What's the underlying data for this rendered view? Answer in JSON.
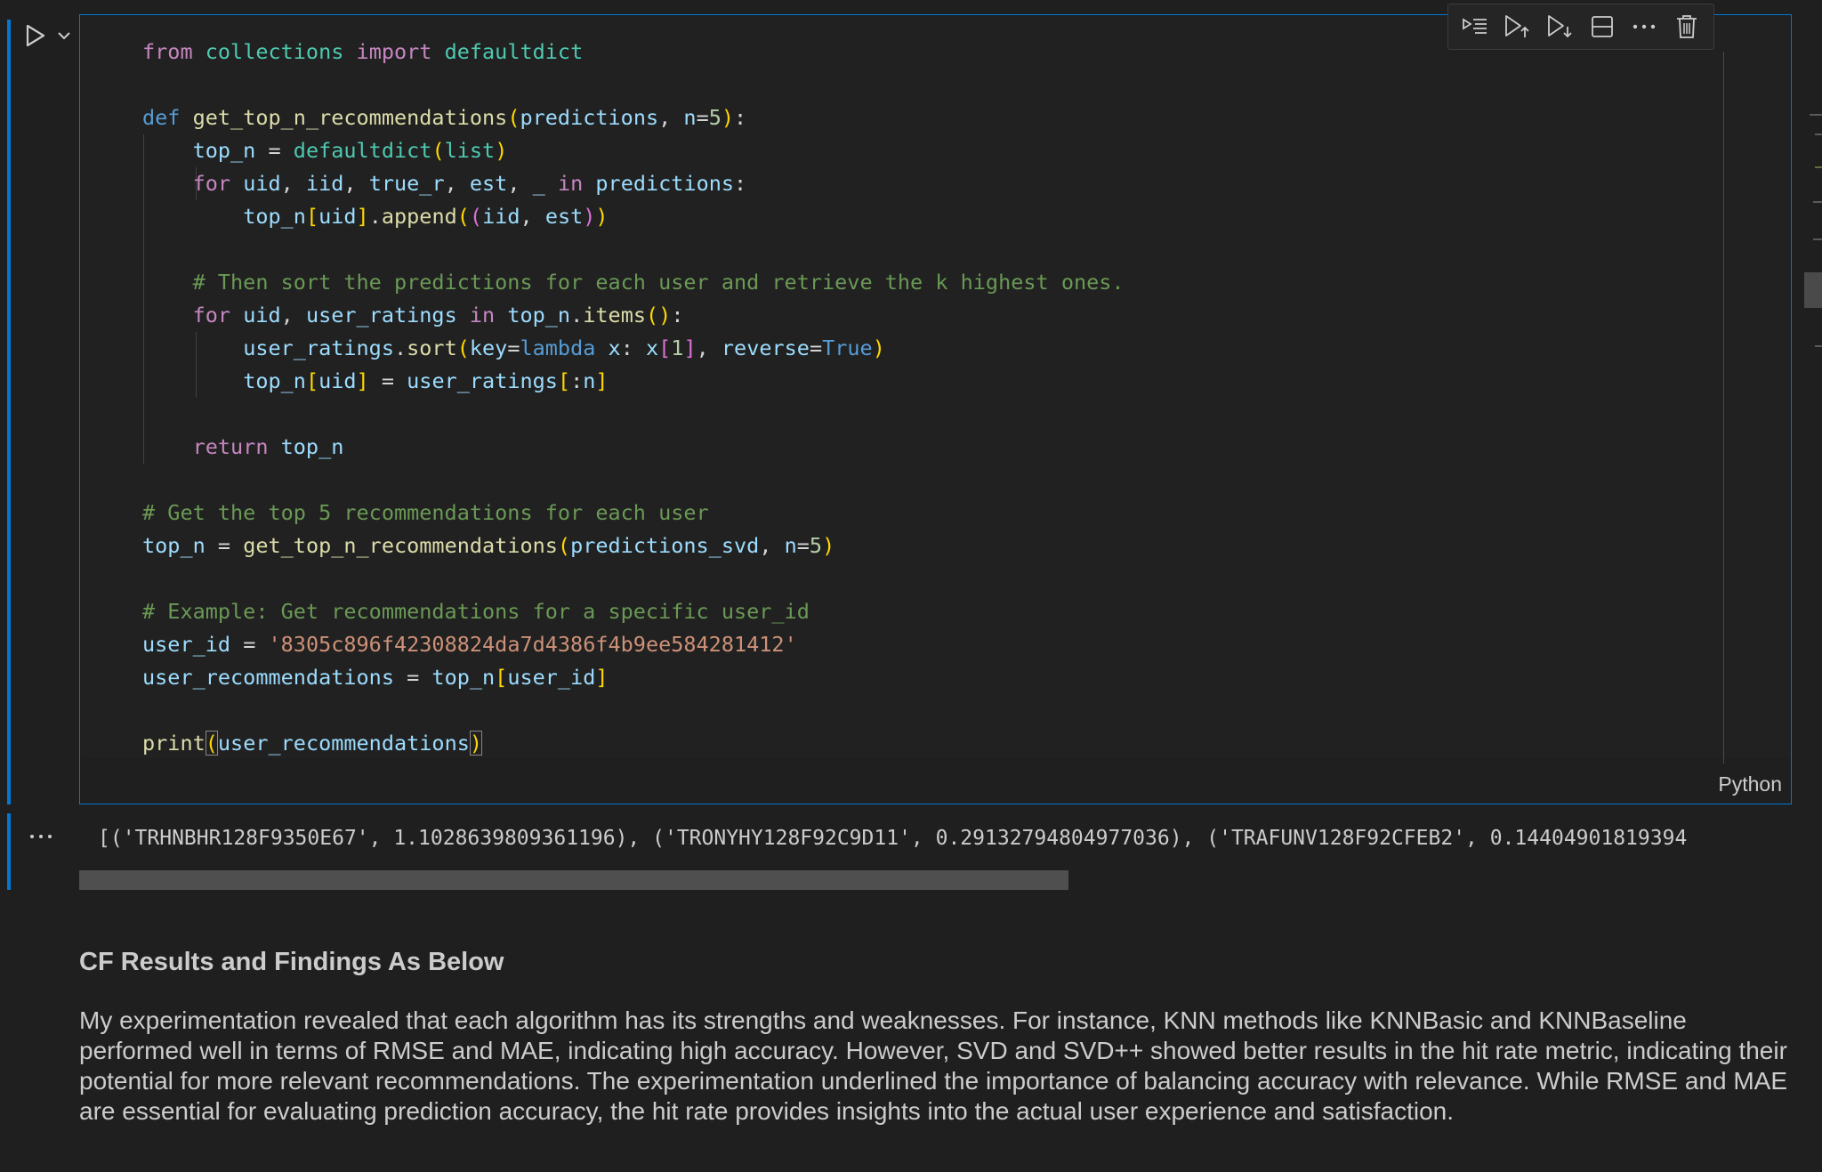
{
  "code_cell": {
    "language": "Python",
    "lines": [
      [
        [
          "kw",
          "from"
        ],
        [
          "op",
          " "
        ],
        [
          "cls",
          "collections"
        ],
        [
          "op",
          " "
        ],
        [
          "kw",
          "import"
        ],
        [
          "op",
          " "
        ],
        [
          "cls",
          "defaultdict"
        ]
      ],
      [],
      [
        [
          "def",
          "def"
        ],
        [
          "op",
          " "
        ],
        [
          "fn",
          "get_top_n_recommendations"
        ],
        [
          "p1",
          "("
        ],
        [
          "var",
          "predictions"
        ],
        [
          "op",
          ", "
        ],
        [
          "var",
          "n"
        ],
        [
          "op",
          "="
        ],
        [
          "num",
          "5"
        ],
        [
          "p1",
          ")"
        ],
        [
          "op",
          ":"
        ]
      ],
      [
        [
          "op",
          "    "
        ],
        [
          "var",
          "top_n"
        ],
        [
          "op",
          " = "
        ],
        [
          "cls",
          "defaultdict"
        ],
        [
          "p1",
          "("
        ],
        [
          "cls",
          "list"
        ],
        [
          "p1",
          ")"
        ]
      ],
      [
        [
          "op",
          "    "
        ],
        [
          "kw",
          "for"
        ],
        [
          "op",
          " "
        ],
        [
          "var",
          "uid"
        ],
        [
          "op",
          ", "
        ],
        [
          "var",
          "iid"
        ],
        [
          "op",
          ", "
        ],
        [
          "var",
          "true_r"
        ],
        [
          "op",
          ", "
        ],
        [
          "var",
          "est"
        ],
        [
          "op",
          ", "
        ],
        [
          "var",
          "_"
        ],
        [
          "op",
          " "
        ],
        [
          "kw",
          "in"
        ],
        [
          "op",
          " "
        ],
        [
          "var",
          "predictions"
        ],
        [
          "op",
          ":"
        ]
      ],
      [
        [
          "op",
          "        "
        ],
        [
          "var",
          "top_n"
        ],
        [
          "p1",
          "["
        ],
        [
          "var",
          "uid"
        ],
        [
          "p1",
          "]"
        ],
        [
          "op",
          "."
        ],
        [
          "fn",
          "append"
        ],
        [
          "p1",
          "("
        ],
        [
          "p2",
          "("
        ],
        [
          "var",
          "iid"
        ],
        [
          "op",
          ", "
        ],
        [
          "var",
          "est"
        ],
        [
          "p2",
          ")"
        ],
        [
          "p1",
          ")"
        ]
      ],
      [],
      [
        [
          "op",
          "    "
        ],
        [
          "cm",
          "# Then sort the predictions for each user and retrieve the k highest ones."
        ]
      ],
      [
        [
          "op",
          "    "
        ],
        [
          "kw",
          "for"
        ],
        [
          "op",
          " "
        ],
        [
          "var",
          "uid"
        ],
        [
          "op",
          ", "
        ],
        [
          "var",
          "user_ratings"
        ],
        [
          "op",
          " "
        ],
        [
          "kw",
          "in"
        ],
        [
          "op",
          " "
        ],
        [
          "var",
          "top_n"
        ],
        [
          "op",
          "."
        ],
        [
          "fn",
          "items"
        ],
        [
          "p1",
          "("
        ],
        [
          "p1",
          ")"
        ],
        [
          "op",
          ":"
        ]
      ],
      [
        [
          "op",
          "        "
        ],
        [
          "var",
          "user_ratings"
        ],
        [
          "op",
          "."
        ],
        [
          "fn",
          "sort"
        ],
        [
          "p1",
          "("
        ],
        [
          "var",
          "key"
        ],
        [
          "op",
          "="
        ],
        [
          "def",
          "lambda"
        ],
        [
          "op",
          " "
        ],
        [
          "var",
          "x"
        ],
        [
          "op",
          ": "
        ],
        [
          "var",
          "x"
        ],
        [
          "p2",
          "["
        ],
        [
          "num",
          "1"
        ],
        [
          "p2",
          "]"
        ],
        [
          "op",
          ", "
        ],
        [
          "var",
          "reverse"
        ],
        [
          "op",
          "="
        ],
        [
          "const",
          "True"
        ],
        [
          "p1",
          ")"
        ]
      ],
      [
        [
          "op",
          "        "
        ],
        [
          "var",
          "top_n"
        ],
        [
          "p1",
          "["
        ],
        [
          "var",
          "uid"
        ],
        [
          "p1",
          "]"
        ],
        [
          "op",
          " = "
        ],
        [
          "var",
          "user_ratings"
        ],
        [
          "p1",
          "["
        ],
        [
          "op",
          ":"
        ],
        [
          "var",
          "n"
        ],
        [
          "p1",
          "]"
        ]
      ],
      [],
      [
        [
          "op",
          "    "
        ],
        [
          "kw",
          "return"
        ],
        [
          "op",
          " "
        ],
        [
          "var",
          "top_n"
        ]
      ],
      [],
      [
        [
          "cm",
          "# Get the top 5 recommendations for each user"
        ]
      ],
      [
        [
          "var",
          "top_n"
        ],
        [
          "op",
          " = "
        ],
        [
          "fn",
          "get_top_n_recommendations"
        ],
        [
          "p1",
          "("
        ],
        [
          "var",
          "predictions_svd"
        ],
        [
          "op",
          ", "
        ],
        [
          "var",
          "n"
        ],
        [
          "op",
          "="
        ],
        [
          "num",
          "5"
        ],
        [
          "p1",
          ")"
        ]
      ],
      [],
      [
        [
          "cm",
          "# Example: Get recommendations for a specific user_id"
        ]
      ],
      [
        [
          "var",
          "user_id"
        ],
        [
          "op",
          " = "
        ],
        [
          "str",
          "'8305c896f42308824da7d4386f4b9ee584281412'"
        ]
      ],
      [
        [
          "var",
          "user_recommendations"
        ],
        [
          "op",
          " = "
        ],
        [
          "var",
          "top_n"
        ],
        [
          "p1",
          "["
        ],
        [
          "var",
          "user_id"
        ],
        [
          "p1",
          "]"
        ]
      ],
      [],
      [
        [
          "fn",
          "print"
        ],
        [
          "p1 cursor",
          "("
        ],
        [
          "var",
          "user_recommendations"
        ],
        [
          "p1 cursor",
          ")"
        ]
      ]
    ]
  },
  "toolbar": {
    "icons": [
      "execute-above-icon",
      "run-above-icon",
      "run-below-icon",
      "split-cell-icon",
      "more-icon",
      "delete-icon"
    ]
  },
  "output": {
    "text": "[('TRHNBHR128F9350E67', 1.1028639809361196), ('TRONYHY128F92C9D11', 0.29132794804977036), ('TRAFUNV128F92CFEB2', 0.14404901819394"
  },
  "markdown": {
    "heading": "CF Results and Findings As Below",
    "paragraph": "My experimentation revealed that each algorithm has its strengths and weaknesses. For instance, KNN methods like KNNBasic and KNNBaseline performed well in terms of RMSE and MAE, indicating high accuracy. However, SVD and SVD++ showed better results in the hit rate metric, indicating their potential for more relevant recommendations. The experimentation underlined the importance of balancing accuracy with relevance. While RMSE and MAE are essential for evaluating prediction accuracy, the hit rate provides insights into the actual user experience and satisfaction."
  },
  "colors": {
    "accent": "#0078d4",
    "background": "#1f1f1f",
    "editor_background": "#212121"
  }
}
